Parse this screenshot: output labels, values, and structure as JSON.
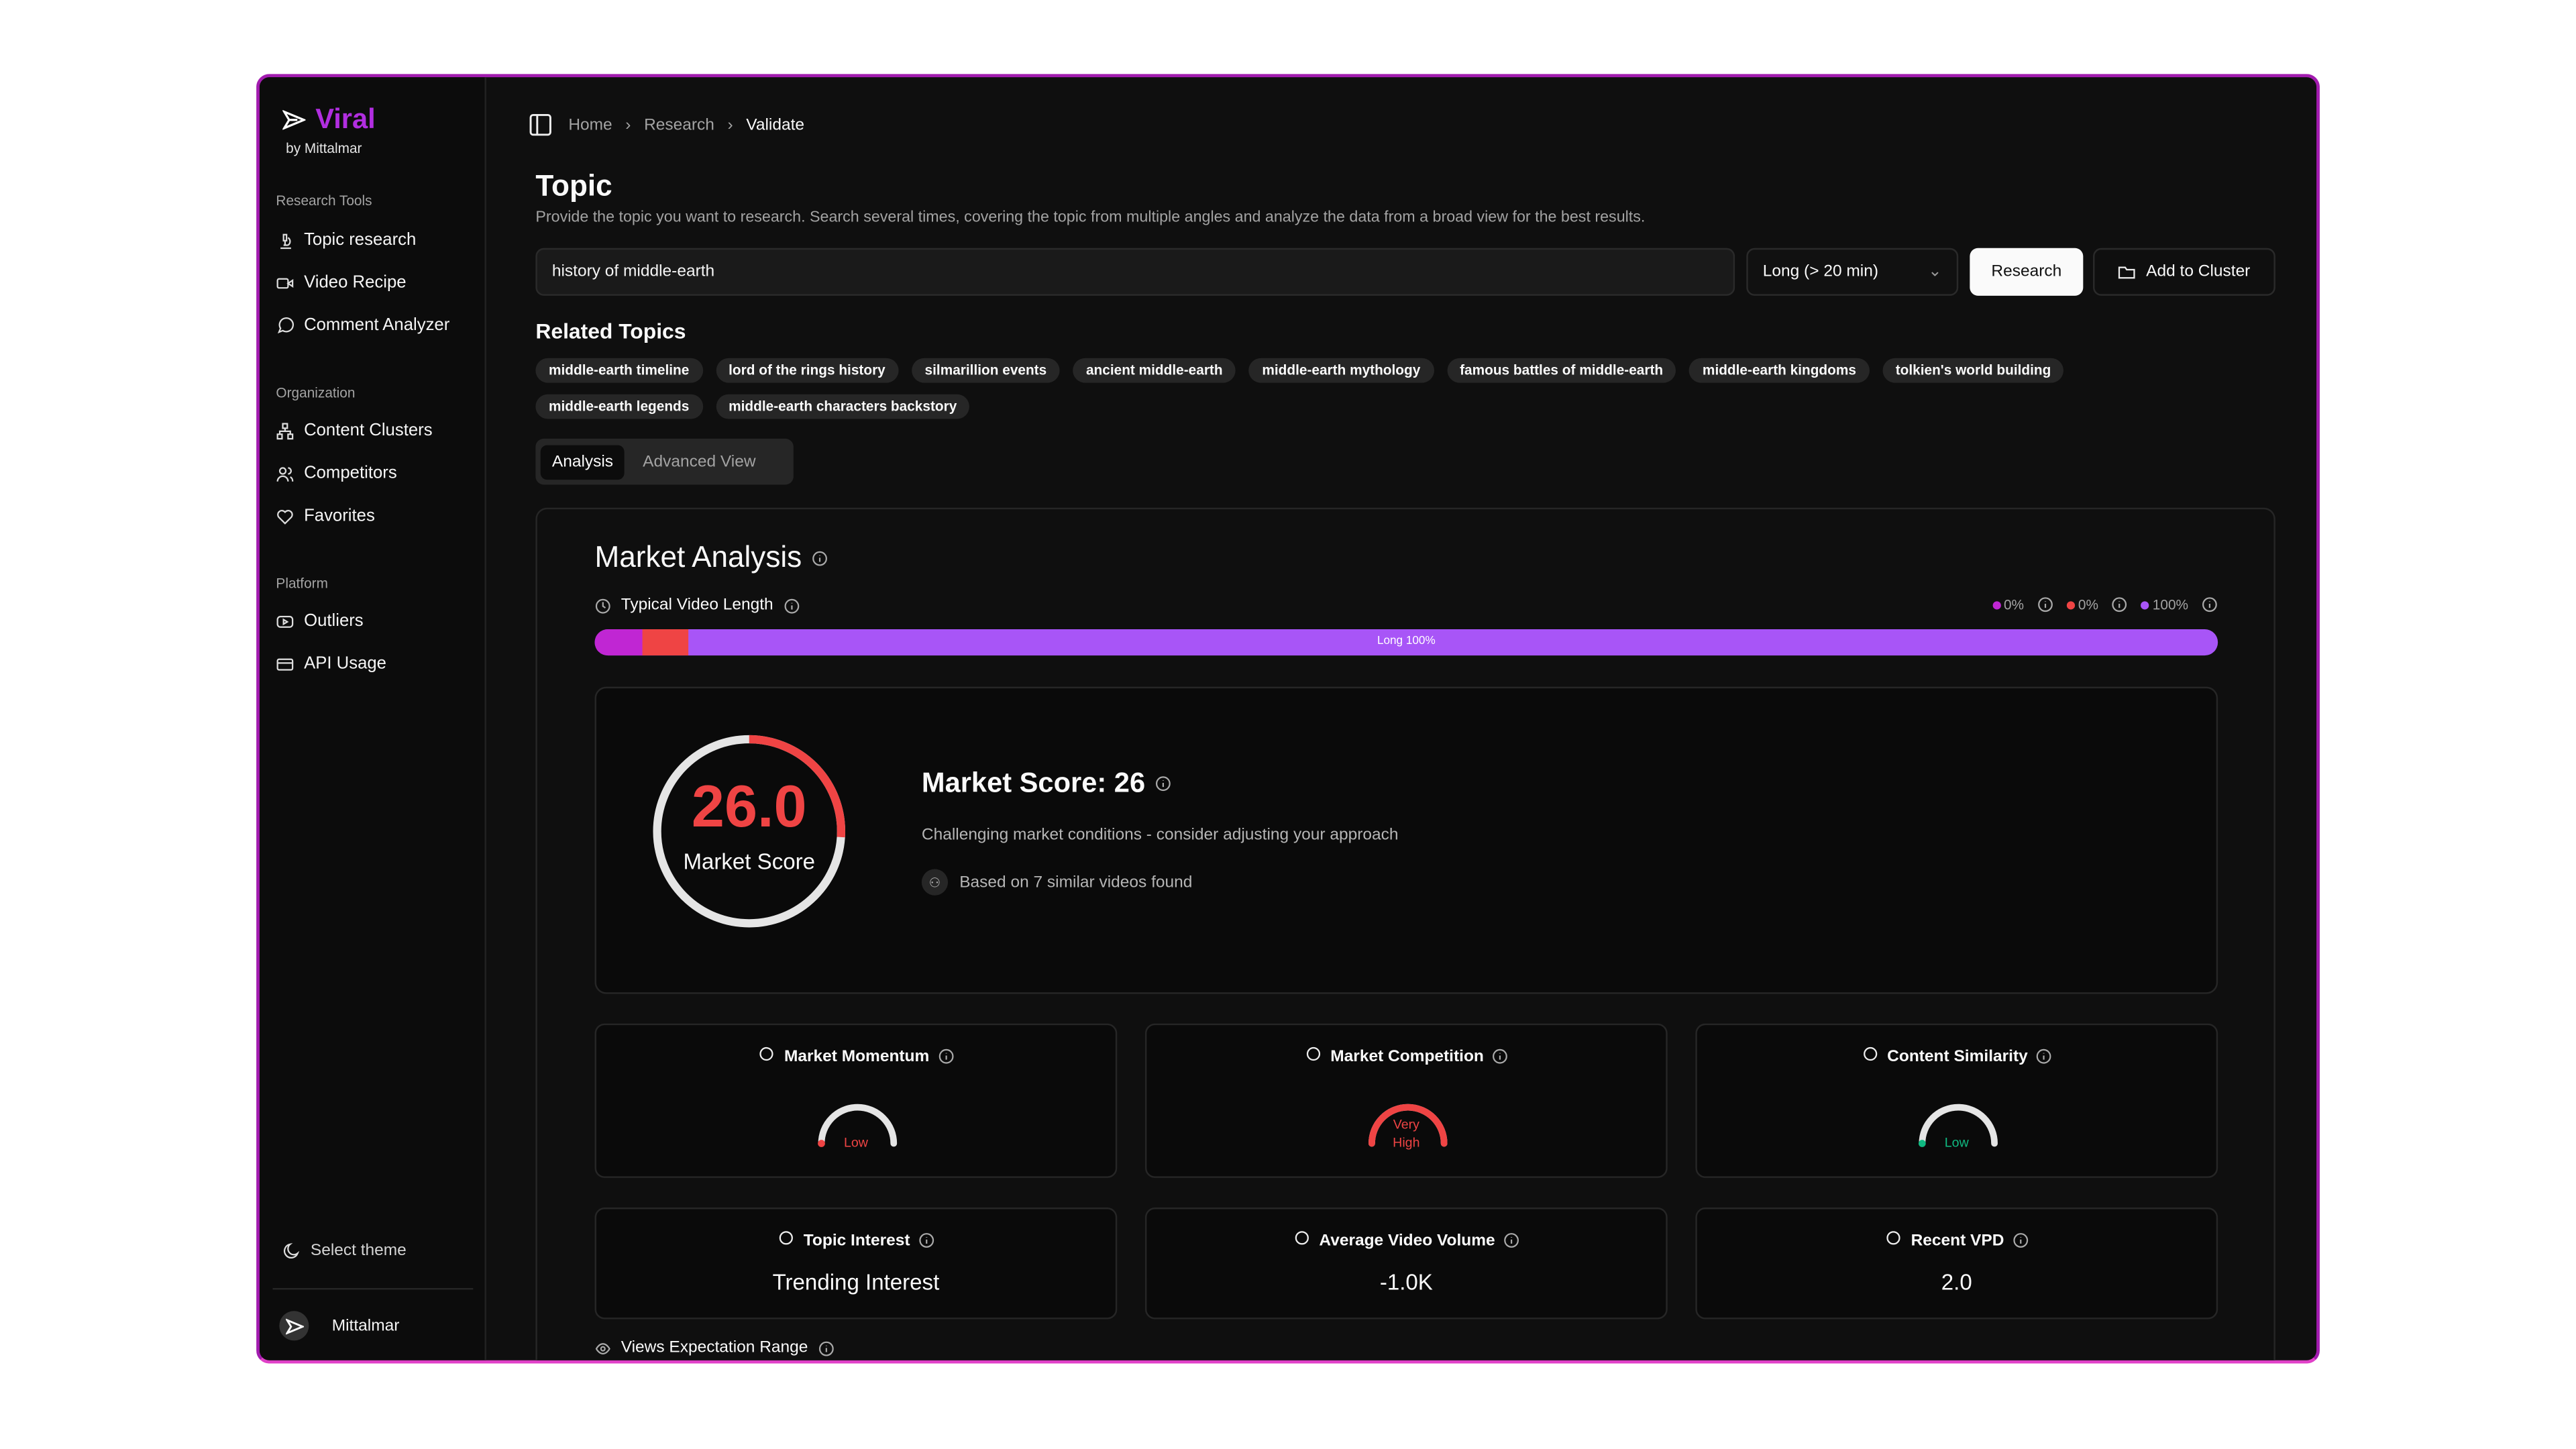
{
  "brand": {
    "name": "Viral",
    "byline": "by Mittalmar",
    "color": "#b12ee0"
  },
  "sidebar": {
    "sections": [
      {
        "label": "Research Tools",
        "items": [
          {
            "label": "Topic research",
            "icon": "microscope-icon"
          },
          {
            "label": "Video Recipe",
            "icon": "video-icon"
          },
          {
            "label": "Comment Analyzer",
            "icon": "message-circle-icon"
          }
        ]
      },
      {
        "label": "Organization",
        "items": [
          {
            "label": "Content Clusters",
            "icon": "network-icon"
          },
          {
            "label": "Competitors",
            "icon": "users-icon"
          },
          {
            "label": "Favorites",
            "icon": "heart-icon"
          }
        ]
      },
      {
        "label": "Platform",
        "items": [
          {
            "label": "Outliers",
            "icon": "youtube-icon"
          },
          {
            "label": "API Usage",
            "icon": "credit-card-icon"
          }
        ]
      }
    ],
    "theme_label": "Select theme",
    "user": "Mittalmar"
  },
  "breadcrumb": [
    "Home",
    "Research",
    "Validate"
  ],
  "topic": {
    "title": "Topic",
    "description": "Provide the topic you want to research. Search several times, covering the topic from multiple angles and analyze the data from a broad view for the best results.",
    "input_value": "history of middle-earth",
    "length_select": "Long (> 20 min)",
    "research_button": "Research",
    "cluster_button": "Add to Cluster"
  },
  "related": {
    "title": "Related Topics",
    "chips": [
      "middle-earth timeline",
      "lord of the rings history",
      "silmarillion events",
      "ancient middle-earth",
      "middle-earth mythology",
      "famous battles of middle-earth",
      "middle-earth kingdoms",
      "tolkien's world building",
      "middle-earth legends",
      "middle-earth characters backstory"
    ]
  },
  "tabs": [
    "Analysis",
    "Advanced View"
  ],
  "analysis": {
    "title": "Market Analysis",
    "video_length": {
      "title": "Typical Video Length",
      "legend": [
        {
          "value": "0%",
          "color": "#c026d3"
        },
        {
          "value": "0%",
          "color": "#ef4444"
        },
        {
          "value": "100%",
          "color": "#a855f7"
        }
      ],
      "bar_label": "Long 100%"
    },
    "score": {
      "value": "26.0",
      "percent": 26,
      "caption": "Market Score",
      "heading": "Market Score: 26",
      "subtitle": "Challenging market conditions - consider adjusting your approach",
      "similar": "Based on 7 similar videos found",
      "color": "#ef4444"
    },
    "metrics": [
      {
        "title": "Market Momentum",
        "icon": "trending-up-icon",
        "gauge_label": "Low",
        "level": 0.02,
        "color": "#ef4444"
      },
      {
        "title": "Market Competition",
        "icon": "users-icon",
        "gauge_label_1": "Very",
        "gauge_label_2": "High",
        "level": 1,
        "color": "#ef4444"
      },
      {
        "title": "Content Similarity",
        "icon": "target-icon",
        "gauge_label": "Low",
        "level": 0.02,
        "color": "#10b981"
      }
    ],
    "stats": [
      {
        "title": "Topic Interest",
        "icon": "network-icon",
        "value": "Trending Interest"
      },
      {
        "title": "Average Video Volume",
        "icon": "bar-chart-icon",
        "value": "-1.0K"
      },
      {
        "title": "Recent VPD",
        "icon": "bar-chart-icon",
        "value": "2.0"
      }
    ],
    "views_range": "Views Expectation Range"
  }
}
